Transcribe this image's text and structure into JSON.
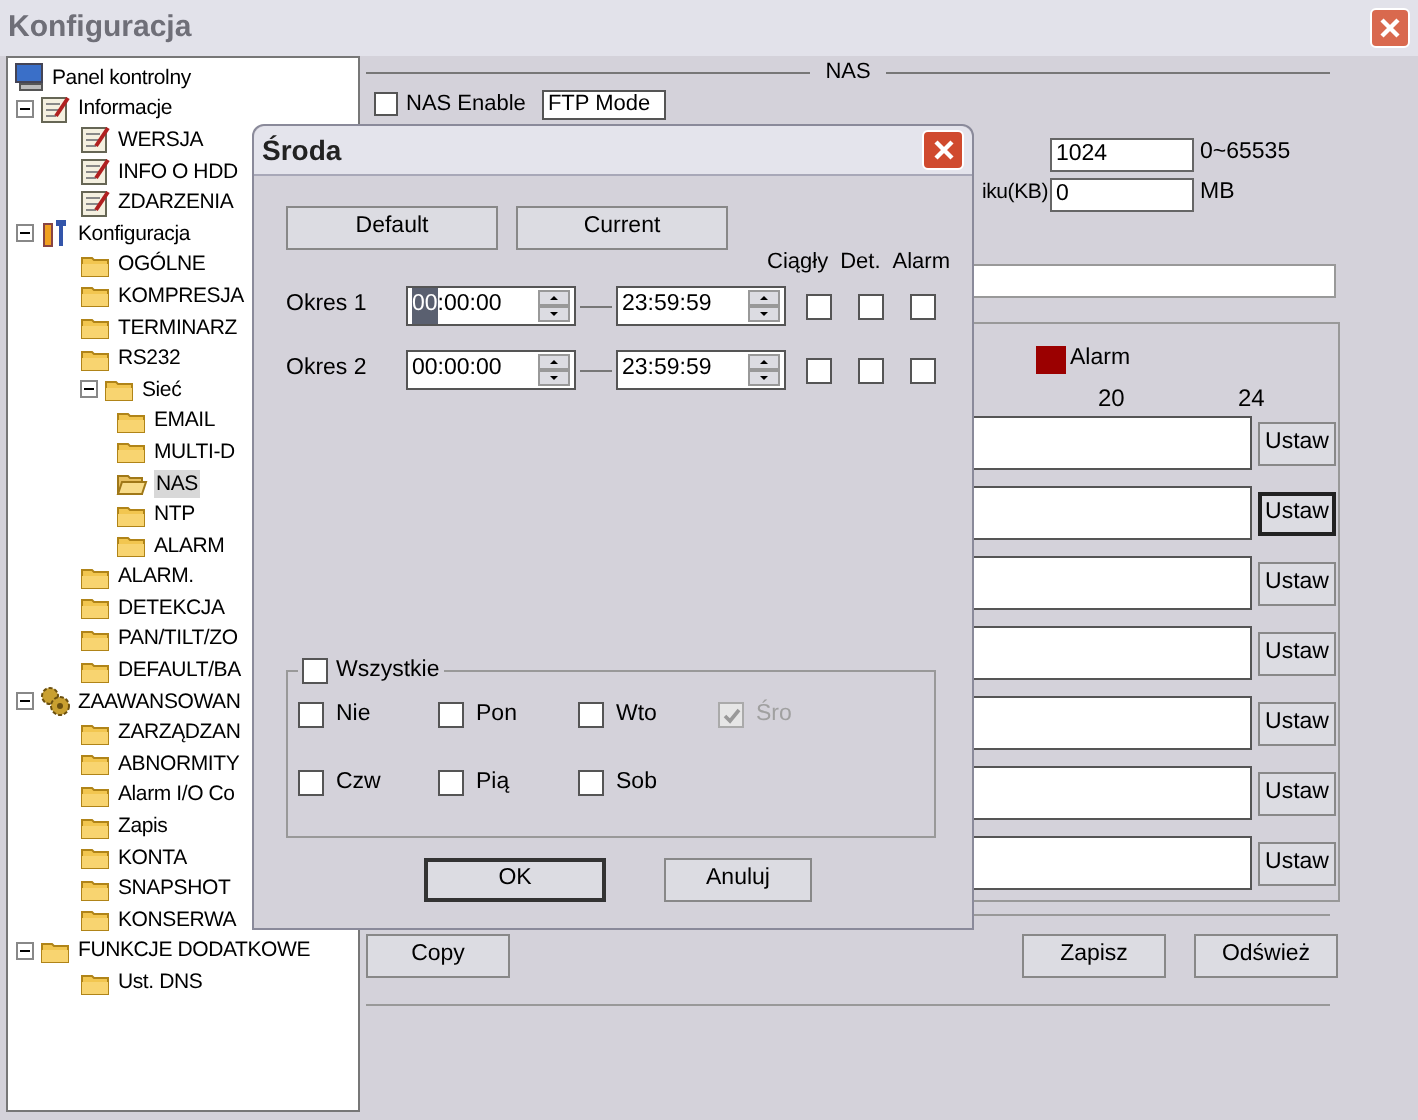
{
  "window": {
    "title": "Konfiguracja"
  },
  "tree": [
    {
      "label": "Panel kontrolny",
      "kind": "computer",
      "selected": false
    },
    {
      "label": "Informacje",
      "kind": "note",
      "selected": false,
      "expanded": true,
      "children": [
        {
          "label": "WERSJA",
          "kind": "note",
          "selected": false
        },
        {
          "label": "INFO O HDD",
          "kind": "note",
          "selected": false
        },
        {
          "label": "ZDARZENIA",
          "kind": "note",
          "selected": false
        }
      ]
    },
    {
      "label": "Konfiguracja",
      "kind": "tools",
      "selected": false,
      "expanded": true,
      "children": [
        {
          "label": "OGÓLNE",
          "kind": "folder",
          "selected": false
        },
        {
          "label": "KOMPRESJA",
          "kind": "folder",
          "selected": false
        },
        {
          "label": "TERMINARZ",
          "kind": "folder",
          "selected": false
        },
        {
          "label": "RS232",
          "kind": "folder",
          "selected": false
        },
        {
          "label": "Sieć",
          "kind": "folder",
          "selected": false,
          "expanded": true,
          "children": [
            {
              "label": "EMAIL",
              "kind": "folder",
              "selected": false
            },
            {
              "label": "MULTI-D",
              "kind": "folder",
              "selected": false
            },
            {
              "label": "NAS",
              "kind": "folder",
              "selected": true
            },
            {
              "label": "NTP",
              "kind": "folder",
              "selected": false
            },
            {
              "label": "ALARM",
              "kind": "folder",
              "selected": false
            }
          ]
        },
        {
          "label": "ALARM.",
          "kind": "folder",
          "selected": false
        },
        {
          "label": "DETEKCJA",
          "kind": "folder",
          "selected": false
        },
        {
          "label": "PAN/TILT/ZO",
          "kind": "folder",
          "selected": false
        },
        {
          "label": "DEFAULT/BA",
          "kind": "folder",
          "selected": false
        }
      ]
    },
    {
      "label": "ZAAWANSOWAN",
      "kind": "gears",
      "selected": false,
      "expanded": true,
      "children": [
        {
          "label": "ZARZĄDZAN",
          "kind": "folder",
          "selected": false
        },
        {
          "label": "ABNORMITY",
          "kind": "folder",
          "selected": false
        },
        {
          "label": "Alarm I/O Co",
          "kind": "folder",
          "selected": false
        },
        {
          "label": "Zapis",
          "kind": "folder",
          "selected": false
        },
        {
          "label": "KONTA",
          "kind": "folder",
          "selected": false
        },
        {
          "label": "SNAPSHOT",
          "kind": "folder",
          "selected": false
        },
        {
          "label": "KONSERWA",
          "kind": "folder",
          "selected": false
        }
      ]
    },
    {
      "label": "FUNKCJE DODATKOWE",
      "kind": "folder",
      "selected": false,
      "expanded": true,
      "children": [
        {
          "label": "Ust. DNS",
          "kind": "folder",
          "selected": false
        }
      ]
    }
  ],
  "nas": {
    "header": "NAS",
    "enable": {
      "label": "NAS Enable",
      "checked": false
    },
    "mode": "FTP Mode",
    "fields": [
      {
        "value": "1024",
        "unit": "0~65535"
      },
      {
        "label": "iku(KB)",
        "value": "0",
        "unit": "MB"
      }
    ],
    "legend": {
      "label": "Alarm",
      "color": "#9b0000"
    },
    "ticks": [
      "20",
      "24"
    ],
    "rows": [
      {
        "button": "Ustaw",
        "focused": false
      },
      {
        "button": "Ustaw",
        "focused": true
      },
      {
        "button": "Ustaw",
        "focused": false
      },
      {
        "button": "Ustaw",
        "focused": false
      },
      {
        "button": "Ustaw",
        "focused": false
      },
      {
        "button": "Ustaw",
        "focused": false
      },
      {
        "button": "Ustaw",
        "focused": false
      }
    ],
    "buttons": [
      "Copy",
      "Zapisz",
      "Odśwież"
    ]
  },
  "dialog": {
    "title": "Środa",
    "buttons": [
      "Default",
      "Current"
    ],
    "columns": [
      "Ciągły",
      "Det.",
      "Alarm"
    ],
    "periods": [
      {
        "label": "Okres 1",
        "start": "00:00:00",
        "end": "23:59:59",
        "start_focused": true,
        "checks": [
          false,
          false,
          false
        ]
      },
      {
        "label": "Okres 2",
        "start": "00:00:00",
        "end": "23:59:59",
        "start_focused": false,
        "checks": [
          false,
          false,
          false
        ]
      }
    ],
    "all": {
      "label": "Wszystkie",
      "checked": false
    },
    "days": [
      {
        "label": "Nie",
        "checked": false,
        "disabled": false
      },
      {
        "label": "Pon",
        "checked": false,
        "disabled": false
      },
      {
        "label": "Wto",
        "checked": false,
        "disabled": false
      },
      {
        "label": "Śro",
        "checked": true,
        "disabled": true
      },
      {
        "label": "Czw",
        "checked": false,
        "disabled": false
      },
      {
        "label": "Pią",
        "checked": false,
        "disabled": false
      },
      {
        "label": "Sob",
        "checked": false,
        "disabled": false
      }
    ],
    "ok": "OK",
    "cancel": "Anuluj"
  }
}
